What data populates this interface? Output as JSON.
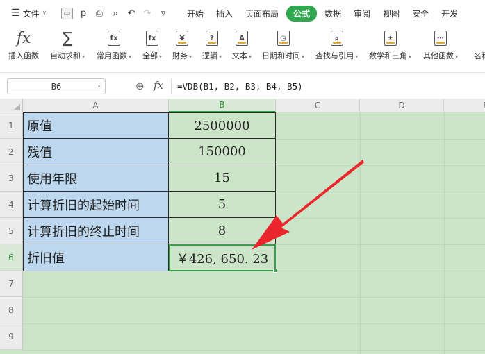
{
  "menubar": {
    "file_label": "文件",
    "tabs": [
      "开始",
      "插入",
      "页面布局",
      "公式",
      "数据",
      "审阅",
      "视图",
      "安全",
      "开发"
    ],
    "active_tab": "公式"
  },
  "ribbon": {
    "items": [
      {
        "label": "插入函数",
        "icon": "fx-icon",
        "dropdown": false
      },
      {
        "label": "自动求和",
        "icon": "sigma-icon",
        "dropdown": true
      },
      {
        "label": "常用函数",
        "icon": "star-fx-icon",
        "dropdown": true
      },
      {
        "label": "全部",
        "icon": "fx-box-icon",
        "dropdown": true
      },
      {
        "label": "财务",
        "icon": "yen-book-icon",
        "dropdown": true
      },
      {
        "label": "逻辑",
        "icon": "question-book-icon",
        "dropdown": true
      },
      {
        "label": "文本",
        "icon": "a-book-icon",
        "dropdown": true
      },
      {
        "label": "日期和时间",
        "icon": "clock-book-icon",
        "dropdown": true
      },
      {
        "label": "查找与引用",
        "icon": "search-book-icon",
        "dropdown": true
      },
      {
        "label": "数学和三角",
        "icon": "math-book-icon",
        "dropdown": true
      },
      {
        "label": "其他函数",
        "icon": "more-book-icon",
        "dropdown": true
      },
      {
        "label": "名称",
        "icon": "name-icon",
        "dropdown": false
      }
    ]
  },
  "formula_bar": {
    "name_box": "B6",
    "fx_label": "fx",
    "formula": "=VDB(B1, B2, B3, B4, B5)"
  },
  "sheet": {
    "columns": [
      "A",
      "B",
      "C",
      "D",
      "E"
    ],
    "selected_column": "B",
    "row_numbers": [
      "1",
      "2",
      "3",
      "4",
      "5",
      "6",
      "7",
      "8",
      "9"
    ],
    "selected_row": "6",
    "rows": [
      {
        "a": "原值",
        "b": "2500000"
      },
      {
        "a": "残值",
        "b": "150000"
      },
      {
        "a": "使用年限",
        "b": "15"
      },
      {
        "a": "计算折旧的起始时间",
        "b": "5"
      },
      {
        "a": "计算折旧的终止时间",
        "b": "8"
      },
      {
        "a": "折旧值",
        "b": "￥426, 650. 23"
      }
    ],
    "annotation_color": "#e8262b",
    "selection_color": "#3aa04c"
  }
}
